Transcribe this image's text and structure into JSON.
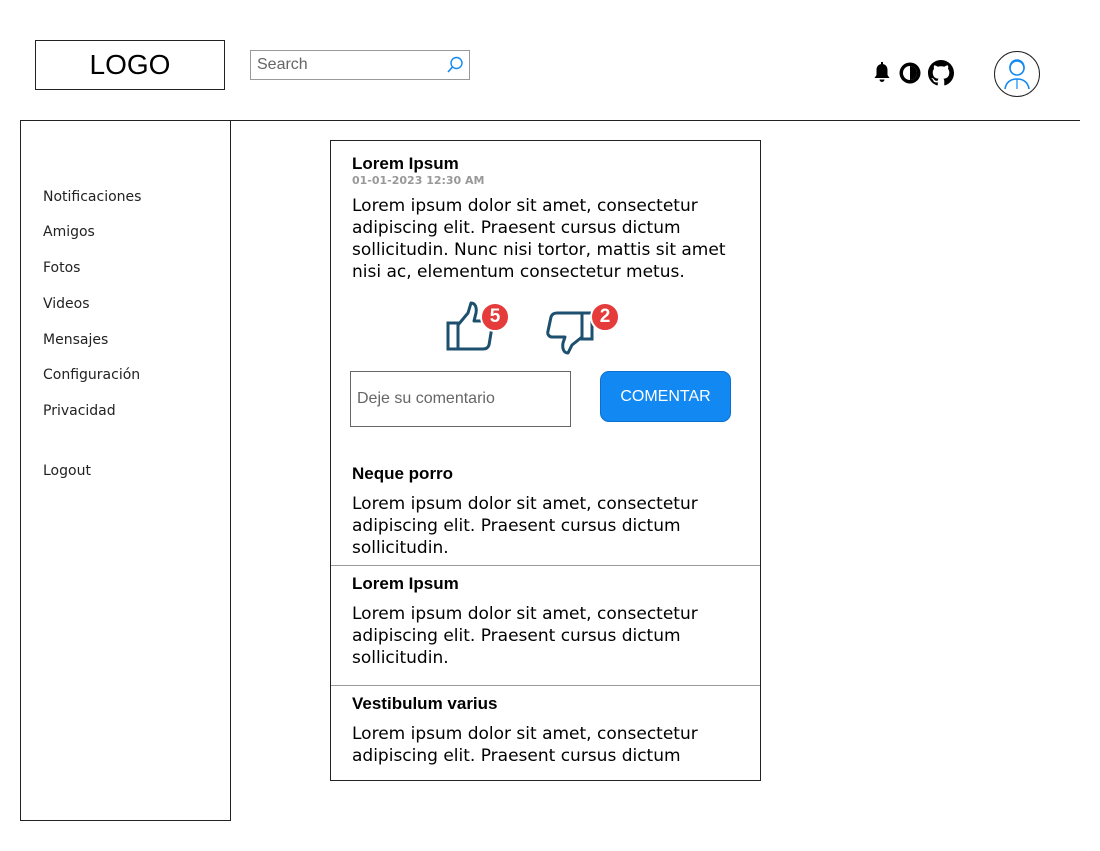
{
  "header": {
    "logo_text": "LOGO",
    "search_placeholder": "Search",
    "icons": [
      "bell-icon",
      "contrast-icon",
      "github-icon"
    ],
    "avatar_icon": "user-avatar-icon"
  },
  "sidebar": {
    "items": [
      {
        "label": "Notificaciones"
      },
      {
        "label": "Amigos"
      },
      {
        "label": "Fotos"
      },
      {
        "label": "Videos"
      },
      {
        "label": "Mensajes"
      },
      {
        "label": "Configuración"
      },
      {
        "label": "Privacidad"
      }
    ],
    "logout_label": "Logout"
  },
  "feed": {
    "main_post": {
      "title": "Lorem Ipsum",
      "date": "01-01-2023 12:30 AM",
      "body": "Lorem ipsum dolor sit amet, consectetur adipiscing elit. Praesent cursus dictum sollicitudin. Nunc nisi tortor, mattis sit amet nisi ac, elementum consectetur metus.",
      "likes": "5",
      "dislikes": "2",
      "comment_placeholder": "Deje su comentario",
      "comment_button": "COMENTAR"
    },
    "posts": [
      {
        "title": "Neque porro",
        "body": "Lorem ipsum dolor sit amet, consectetur adipiscing elit. Praesent cursus dictum sollicitudin."
      },
      {
        "title": "Lorem Ipsum",
        "body": "Lorem ipsum dolor sit amet, consectetur adipiscing elit. Praesent cursus dictum sollicitudin."
      },
      {
        "title": "Vestibulum varius",
        "body": "Lorem ipsum dolor sit amet, consectetur adipiscing elit. Praesent cursus dictum"
      }
    ]
  },
  "colors": {
    "accent": "#1289f2",
    "badge": "#e53b3b",
    "thumb": "#1d4f6e"
  }
}
